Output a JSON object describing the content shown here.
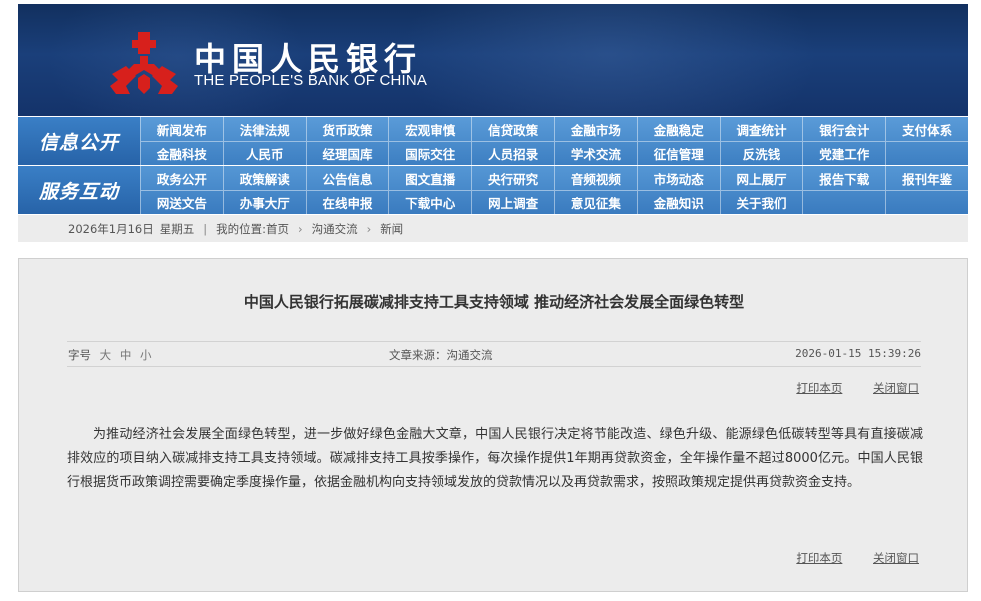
{
  "header": {
    "brand_cn": "中国人民银行",
    "brand_en": "THE PEOPLE'S BANK OF CHINA",
    "colors": {
      "banner": "#1a3f7a",
      "logo": "#d7201c",
      "nav": "#4a8bcd"
    }
  },
  "nav_info": {
    "title": "信息公开",
    "items": [
      "新闻发布",
      "法律法规",
      "货币政策",
      "宏观审慎",
      "信贷政策",
      "金融市场",
      "金融稳定",
      "调查统计",
      "银行会计",
      "支付体系",
      "金融科技",
      "人民币",
      "经理国库",
      "国际交往",
      "人员招录",
      "学术交流",
      "征信管理",
      "反洗钱",
      "党建工作",
      ""
    ]
  },
  "nav_service": {
    "title": "服务互动",
    "items": [
      "政务公开",
      "政策解读",
      "公告信息",
      "图文直播",
      "央行研究",
      "音频视频",
      "市场动态",
      "网上展厅",
      "报告下载",
      "报刊年鉴",
      "网送文告",
      "办事大厅",
      "在线申报",
      "下载中心",
      "网上调查",
      "意见征集",
      "金融知识",
      "关于我们",
      "",
      ""
    ]
  },
  "breadcrumb": {
    "date": "2026年1月16日",
    "weekday": "星期五",
    "location_label": "我的位置:",
    "home": "首页",
    "section": "沟通交流",
    "current": "新闻"
  },
  "article": {
    "title": "中国人民银行拓展碳减排支持工具支持领域  推动经济社会发展全面绿色转型",
    "fontsize_label": "字号",
    "fontsize_options": [
      "大",
      "中",
      "小"
    ],
    "source": "文章来源：沟通交流",
    "datetime": "2026-01-15 15:39:26",
    "print_label": "打印本页",
    "close_label": "关闭窗口",
    "body": "为推动经济社会发展全面绿色转型，进一步做好绿色金融大文章，中国人民银行决定将节能改造、绿色升级、能源绿色低碳转型等具有直接碳减排效应的项目纳入碳减排支持工具支持领域。碳减排支持工具按季操作，每次操作提供1年期再贷款资金，全年操作量不超过8000亿元。中国人民银行根据货币政策调控需要确定季度操作量，依据金融机构向支持领域发放的贷款情况以及再贷款需求，按照政策规定提供再贷款资金支持。"
  }
}
